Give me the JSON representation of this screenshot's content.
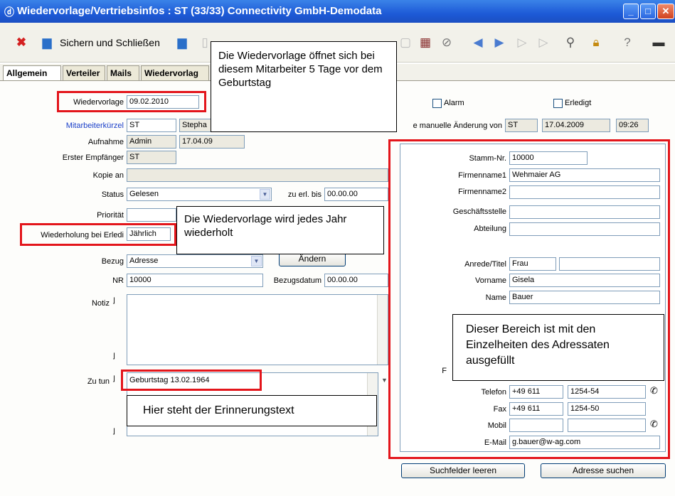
{
  "window": {
    "title": "Wiedervorlage/Vertriebsinfos : ST (33/33) Connectivity GmbH-Demodata"
  },
  "toolbar": {
    "save_close_label": "Sichern und Schließen"
  },
  "tabs": [
    {
      "label": "Allgemein"
    },
    {
      "label": "Verteiler"
    },
    {
      "label": "Mails"
    },
    {
      "label": "Wiedervorlag"
    }
  ],
  "form": {
    "wiedervorlage_label": "Wiedervorlage",
    "wiedervorlage_value": "09.02.2010",
    "mitarbeiter_label": "Mitarbeiterkürzel",
    "mitarbeiter_value": "ST",
    "mitarbeiter_name": "Stepha",
    "aufnahme_label": "Aufnahme",
    "aufnahme_value": "Admin",
    "aufnahme_date": "17.04.09",
    "empfaenger_label": "Erster Empfänger",
    "empfaenger_value": "ST",
    "kopie_label": "Kopie an",
    "kopie_value": "",
    "status_label": "Status",
    "status_value": "Gelesen",
    "zu_erl_label": "zu erl. bis",
    "zu_erl_value": "00.00.00",
    "prioritaet_label": "Priorität",
    "prioritaet_value": "",
    "wiederholung_label": "Wiederholung bei Erledi",
    "wiederholung_value": "Jährlich",
    "bezug_label": "Bezug",
    "bezug_value": "Adresse",
    "aendern_button": "Ändern",
    "nr_label": "NR",
    "nr_value": "10000",
    "bezugsdatum_label": "Bezugsdatum",
    "bezugsdatum_value": "00.00.00",
    "notiz_label": "Notiz",
    "notiz_value": "",
    "zutun_label": "Zu tun",
    "zutun_value": "Geburtstag 13.02.1964",
    "alarm_label": "Alarm",
    "erledigt_label": "Erledigt",
    "letzte_aenderung_label": "e manuelle Änderung von",
    "letzte_aenderung_user": "ST",
    "letzte_aenderung_date": "17.04.2009",
    "letzte_aenderung_time": "09:26"
  },
  "address": {
    "stamm_label": "Stamm-Nr.",
    "stamm_value": "10000",
    "firmenname1_label": "Firmenname1",
    "firmenname1_value": "Wehmaier AG",
    "firmenname2_label": "Firmenname2",
    "firmenname2_value": "",
    "geschaeftsstelle_label": "Geschäftsstelle",
    "geschaeftsstelle_value": "",
    "abteilung_label": "Abteilung",
    "abteilung_value": "",
    "anrede_label": "Anrede/Titel",
    "anrede_value": "Frau",
    "titel_value": "",
    "vorname_label": "Vorname",
    "vorname_value": "Gisela",
    "name_label": "Name",
    "name_value": "Bauer",
    "partial_label": "F",
    "telefon_label": "Telefon",
    "telefon_prefix": "+49 611",
    "telefon_number": "1254-54",
    "fax_label": "Fax",
    "fax_prefix": "+49 611",
    "fax_number": "1254-50",
    "mobil_label": "Mobil",
    "mobil_prefix": "",
    "mobil_number": "",
    "email_label": "E-Mail",
    "email_value": "g.bauer@w-ag.com",
    "suchfelder_button": "Suchfelder leeren",
    "adresse_suchen_button": "Adresse suchen"
  },
  "callouts": {
    "wiedervorlage_text": "Die Wiedervorlage öffnet sich bei diesem Mitarbeiter 5 Tage vor dem Geburtstag",
    "wiederholung_text": "Die Wiedervorlage wird jedes Jahr wiederholt",
    "adressat_text": "Dieser Bereich ist mit den Einzelheiten des Adressaten ausgefüllt",
    "erinnerung_text": "Hier steht der Erinnerungstext"
  },
  "colors": {
    "title_bar": "#1d5ad7",
    "highlight": "#e3151b",
    "link_label": "#1a3fc9"
  }
}
